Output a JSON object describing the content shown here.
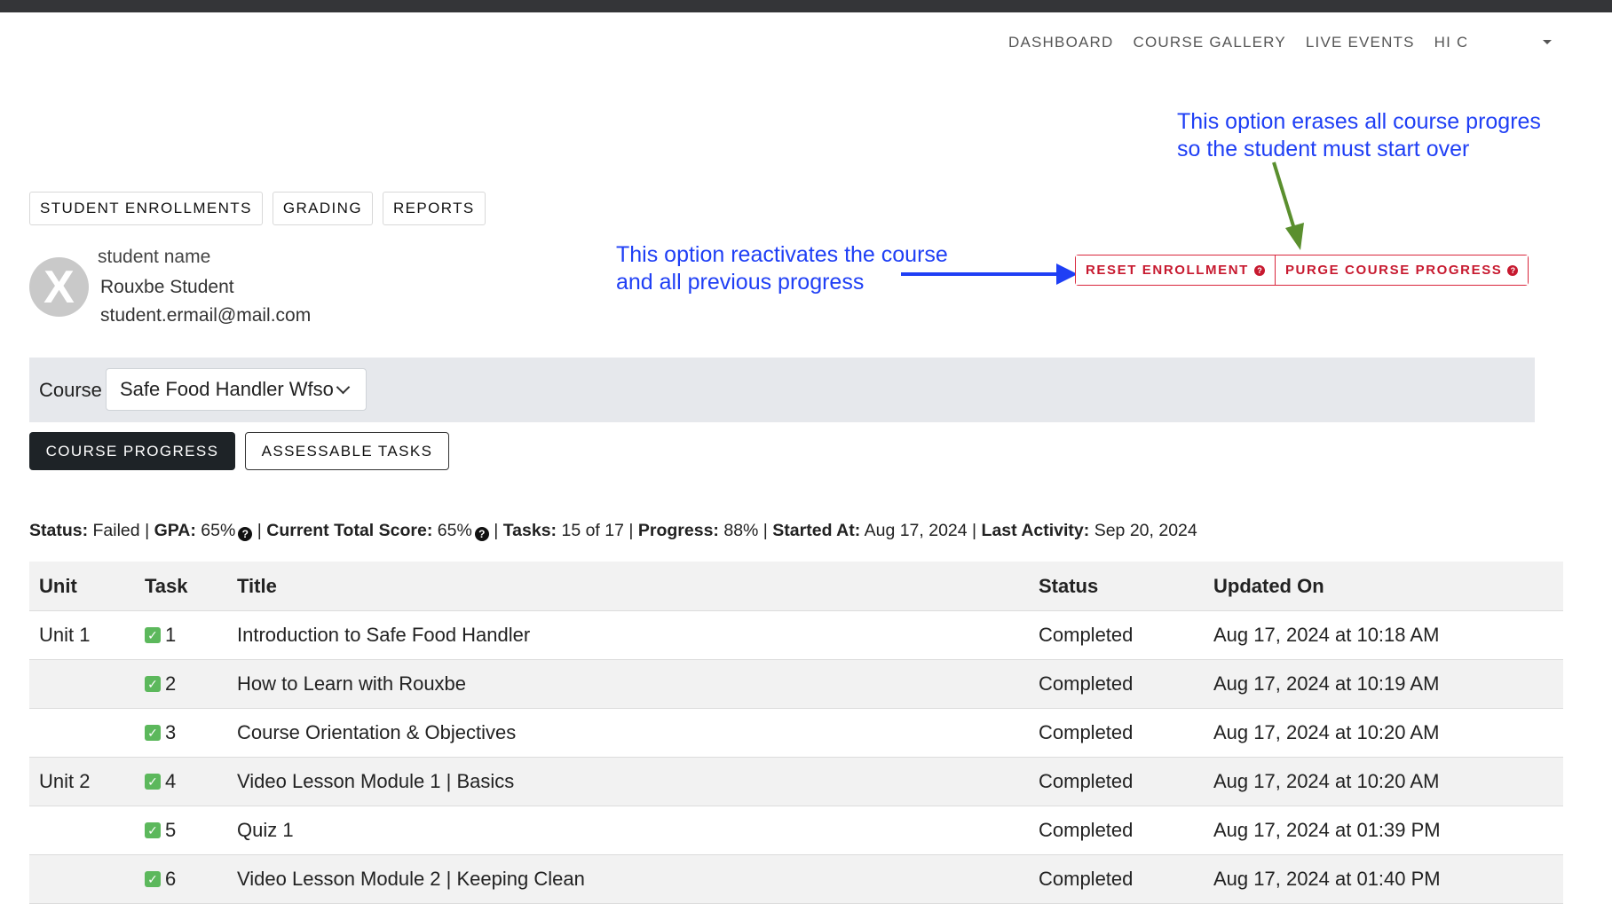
{
  "nav": {
    "items": [
      "DASHBOARD",
      "COURSE GALLERY",
      "LIVE EVENTS"
    ],
    "user_label": "HI C"
  },
  "annotations": {
    "purge": [
      "This option erases all course progres",
      "so the student must start over"
    ],
    "reset": [
      "This option reactivates the course",
      "and all previous progress"
    ],
    "purge_arrow_color": "#5a8f2e",
    "reset_arrow_color": "#1f3ff5"
  },
  "tabs": [
    "STUDENT ENROLLMENTS",
    "GRADING",
    "REPORTS"
  ],
  "student": {
    "avatar_letter": "X",
    "heading": "student name",
    "name": "Rouxbe Student",
    "email": "student.ermail@mail.com"
  },
  "actions": {
    "reset": "RESET ENROLLMENT",
    "purge": "PURGE COURSE PROGRESS",
    "accent_color": "#c7192f"
  },
  "course": {
    "label": "Course",
    "selected": "Safe Food Handler Wfso"
  },
  "subtabs": {
    "progress": "COURSE PROGRESS",
    "assessable": "ASSESSABLE TASKS"
  },
  "status_line": {
    "status_label": "Status:",
    "status_value": "Failed",
    "gpa_label": "GPA:",
    "gpa_value": "65%",
    "score_label": "Current Total Score:",
    "score_value": "65%",
    "tasks_label": "Tasks:",
    "tasks_value": "15 of 17",
    "progress_label": "Progress:",
    "progress_value": "88%",
    "started_label": "Started At:",
    "started_value": "Aug 17, 2024",
    "last_label": "Last Activity:",
    "last_value": "Sep 20, 2024",
    "separator": "|"
  },
  "table": {
    "headers": {
      "unit": "Unit",
      "task": "Task",
      "title": "Title",
      "status": "Status",
      "updated": "Updated On"
    },
    "rows": [
      {
        "unit": "Unit 1",
        "task": "1",
        "title": "Introduction to Safe Food Handler",
        "status": "Completed",
        "updated": "Aug 17, 2024 at 10:18 AM"
      },
      {
        "unit": "",
        "task": "2",
        "title": "How to Learn with Rouxbe",
        "status": "Completed",
        "updated": "Aug 17, 2024 at 10:19 AM"
      },
      {
        "unit": "",
        "task": "3",
        "title": "Course Orientation & Objectives",
        "status": "Completed",
        "updated": "Aug 17, 2024 at 10:20 AM"
      },
      {
        "unit": "Unit 2",
        "task": "4",
        "title": "Video Lesson Module 1 | Basics",
        "status": "Completed",
        "updated": "Aug 17, 2024 at 10:20 AM"
      },
      {
        "unit": "",
        "task": "5",
        "title": "Quiz 1",
        "status": "Completed",
        "updated": "Aug 17, 2024 at 01:39 PM"
      },
      {
        "unit": "",
        "task": "6",
        "title": "Video Lesson Module 2 | Keeping Clean",
        "status": "Completed",
        "updated": "Aug 17, 2024 at 01:40 PM"
      }
    ]
  }
}
